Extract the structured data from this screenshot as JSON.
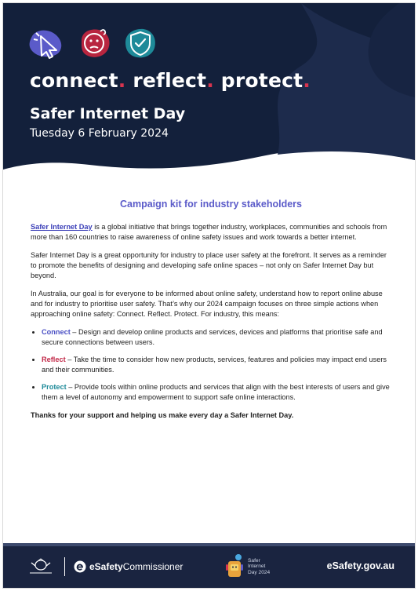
{
  "header": {
    "tagline": {
      "word1": "connect",
      "word2": "reflect",
      "word3": "protect",
      "dot": "."
    },
    "event_title": "Safer Internet Day",
    "event_date": "Tuesday 6 February 2024",
    "colors": {
      "navy": "#13203b",
      "accent_red": "#d8344f",
      "purple": "#5b5bc9",
      "teal": "#1e8a99"
    }
  },
  "content": {
    "kit_title": "Campaign kit for industry stakeholders",
    "intro_link": "Safer Internet Day",
    "intro_rest": " is a global initiative that brings together industry, workplaces, communities and schools from more than 160 countries to raise awareness of online safety issues and work towards a better internet.",
    "para2": "Safer Internet Day is a great opportunity for industry to place user safety at the forefront. It serves as a reminder to promote the benefits of designing and developing safe online spaces – not only on Safer Internet Day but beyond.",
    "para3": "In Australia, our goal is for everyone to be informed about online safety, understand how to report online abuse and for industry to prioritise user safety. That’s why our 2024 campaign focuses on three simple actions when approaching online safety: Connect. Reflect. Protect. For industry, this means:",
    "bullets": [
      {
        "keyword": "Connect",
        "text": " – Design and develop online products and services, devices and platforms that prioritise safe and secure connections between users."
      },
      {
        "keyword": "Reflect",
        "text": " – Take the time to consider how new products, services, features and policies may impact end users and their communities."
      },
      {
        "keyword": "Protect",
        "text": " – Provide tools within online products and services that align with the best interests of users and give them a level of autonomy and empowerment to support safe online interactions."
      }
    ],
    "thanks": "Thanks for your support and helping us make every day a Safer Internet Day."
  },
  "footer": {
    "esafety_bold": "eSafety",
    "esafety_rest": "Commissioner",
    "sid_logo_text": "Safer\nInternet\nDay 2024",
    "website": "eSafety.gov.au",
    "icons": [
      "australian-government-crest-icon",
      "esafety-logo-icon",
      "safer-internet-day-logo-icon"
    ]
  }
}
